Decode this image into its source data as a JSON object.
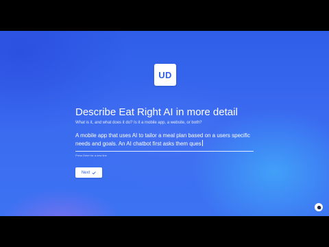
{
  "brand": {
    "logo_text": "UD"
  },
  "question": {
    "title": "Describe Eat Right AI in more detail",
    "subtitle": "What is it, and what does it do? Is it a mobile app, a website, or both?"
  },
  "answer": {
    "value": "A mobile app that uses AI to tailor a meal plan based on a users specific needs and goals. An AI chatbot first asks them ques"
  },
  "hint": {
    "text": "Press Enter for a new line"
  },
  "actions": {
    "next_label": "Next",
    "next_icon": "check-icon",
    "chat_icon": "chat-bubble-icon"
  },
  "colors": {
    "background_primary": "#3a6af0",
    "background_dark": "#2f5ee8",
    "accent": "#2f5fe8",
    "text": "#ffffff"
  }
}
